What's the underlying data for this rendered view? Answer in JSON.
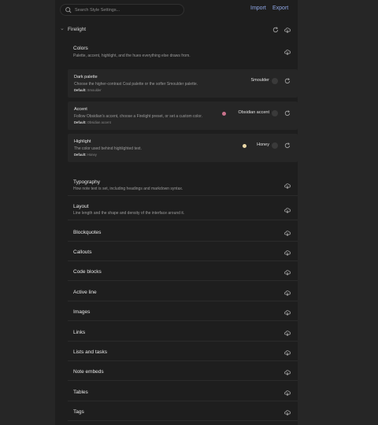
{
  "topbar": {
    "search_placeholder": "Search Style Settings...",
    "import_label": "Import",
    "export_label": "Export"
  },
  "section": {
    "title": "Firelight"
  },
  "colors": {
    "title": "Colors",
    "description": "Palette, accent, highlight, and the hues everything else draws from."
  },
  "settings": [
    {
      "title": "Dark palette",
      "description": "Choose the higher-contrast Coal palette or the softer Smoulder palette.",
      "default_label": "Default:",
      "default_value": "Smoulder",
      "value": "Smoulder"
    },
    {
      "title": "Accent",
      "description": "Follow Obsidian's accent, choose a Firelight preset, or set a custom color.",
      "default_label": "Default:",
      "default_value": "Obsidian accent",
      "value": "Obsidian accent",
      "swatch_color": "#c9728b"
    },
    {
      "title": "Highlight",
      "description": "The color used behind highlighted text.",
      "default_label": "Default:",
      "default_value": "Honey",
      "value": "Honey",
      "swatch_color": "#ecd9a8"
    }
  ],
  "categories": [
    {
      "title": "Typography",
      "description": "How note text is set, including headings and markdown syntax."
    },
    {
      "title": "Layout",
      "description": "Line length and the shape and density of the interface around it."
    },
    {
      "title": "Blockquotes"
    },
    {
      "title": "Callouts"
    },
    {
      "title": "Code blocks"
    },
    {
      "title": "Active line"
    },
    {
      "title": "Images"
    },
    {
      "title": "Links"
    },
    {
      "title": "Lists and tasks"
    },
    {
      "title": "Note embeds"
    },
    {
      "title": "Tables"
    },
    {
      "title": "Tags"
    }
  ],
  "icons": {
    "search": "search-icon",
    "chevron": "chevron-down-icon",
    "reset": "reset-icon",
    "export": "export-icon",
    "settings": "gear-icon"
  },
  "colors_theme": {
    "link": "#8fa7e6",
    "background": "#1e1e1e",
    "card": "#262626"
  }
}
